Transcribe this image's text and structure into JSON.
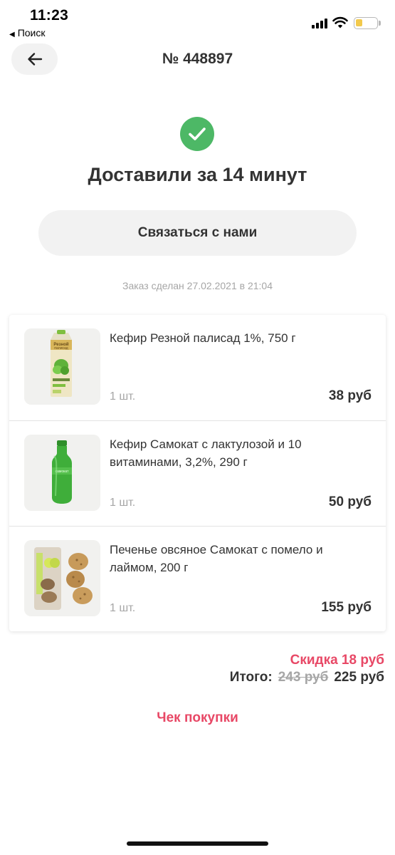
{
  "status_bar": {
    "time": "11:23",
    "back_app": "Поиск",
    "back_icon": "triangle-left-icon"
  },
  "header": {
    "back_icon": "arrow-left-icon",
    "title": "№ 448897"
  },
  "status": {
    "icon": "checkmark-circle-icon",
    "icon_color": "#4db866",
    "text": "Доставили за 14 минут"
  },
  "contact_button": "Связаться с нами",
  "order_date": "Заказ сделан 27.02.2021 в 21:04",
  "items": [
    {
      "name": "Кефир Резной палисад 1%, 750 г",
      "qty": "1 шт.",
      "price": "38 руб",
      "image": "kefir-carton-image"
    },
    {
      "name": "Кефир Самокат с лактулозой и 10 витаминами, 3,2%, 290 г",
      "qty": "1 шт.",
      "price": "50 руб",
      "image": "green-bottle-image"
    },
    {
      "name": "Печенье овсяное Самокат с помело и лаймом, 200 г",
      "qty": "1 шт.",
      "price": "155 руб",
      "image": "oat-cookies-image"
    }
  ],
  "summary": {
    "discount": "Скидка 18 руб",
    "total_label": "Итого:",
    "old_price": "243 руб",
    "new_price": "225 руб"
  },
  "receipt_link": "Чек покупки",
  "colors": {
    "accent": "#e84866",
    "success": "#4db866",
    "button_bg": "#f2f2f2",
    "muted": "#a6a6a6"
  }
}
